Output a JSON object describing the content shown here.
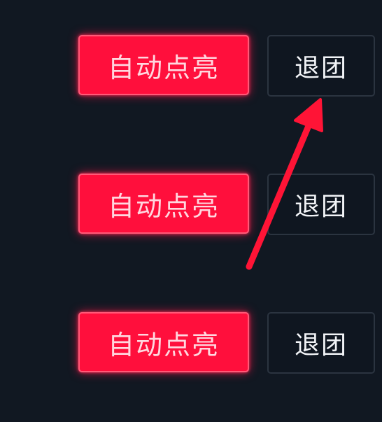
{
  "rows": [
    {
      "auto_light_label": "自动点亮",
      "quit_group_label": "退团"
    },
    {
      "auto_light_label": "自动点亮",
      "quit_group_label": "退团"
    },
    {
      "auto_light_label": "自动点亮",
      "quit_group_label": "退团"
    }
  ],
  "colors": {
    "background": "#111822",
    "auto_button": "#ff0f3c",
    "quit_button": "#0f1620",
    "arrow": "#ff1436"
  },
  "annotation": {
    "icon": "red-arrow-icon",
    "points_to": "quit-group-button"
  }
}
